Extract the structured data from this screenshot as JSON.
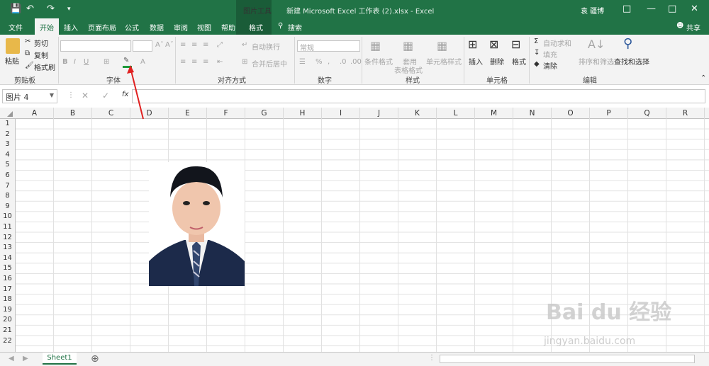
{
  "titlebar": {
    "picture_tools": "图片工具",
    "title": "新建 Microsoft Excel 工作表 (2).xlsx  -  Excel",
    "user": "袁 疆博"
  },
  "tabs": [
    "文件",
    "开始",
    "插入",
    "页面布局",
    "公式",
    "数据",
    "审阅",
    "视图",
    "帮助",
    "格式"
  ],
  "search": "搜索",
  "share": "共享",
  "clipboard": {
    "paste": "粘贴",
    "cut": "剪切",
    "copy": "复制",
    "format_painter": "格式刷",
    "label": "剪贴板"
  },
  "font": {
    "label": "字体"
  },
  "alignment": {
    "wrap": "自动换行",
    "merge": "合并后居中",
    "label": "对齐方式"
  },
  "number": {
    "format": "常规",
    "label": "数字"
  },
  "styles": {
    "conditional": "条件格式",
    "table_format1": "套用",
    "table_format2": "表格格式",
    "cell_style": "单元格样式",
    "label": "样式"
  },
  "cells": {
    "insert": "插入",
    "delete": "删除",
    "format": "格式",
    "label": "单元格"
  },
  "editing": {
    "autosum": "自动求和",
    "fill": "填充",
    "clear": "清除",
    "sort": "排序和筛选",
    "find": "查找和选择",
    "label": "编辑"
  },
  "namebox": "图片 4",
  "columns": [
    "A",
    "B",
    "C",
    "D",
    "E",
    "F",
    "G",
    "H",
    "I",
    "J",
    "K",
    "L",
    "M",
    "N",
    "O",
    "P",
    "Q",
    "R"
  ],
  "rows": [
    "1",
    "2",
    "3",
    "4",
    "5",
    "6",
    "7",
    "8",
    "9",
    "10",
    "11",
    "12",
    "13",
    "14",
    "15",
    "16",
    "17",
    "18",
    "19",
    "20",
    "21",
    "22"
  ],
  "sheet": "Sheet1",
  "watermark": {
    "brand": "Bai du 经验",
    "url": "jingyan.baidu.com"
  }
}
